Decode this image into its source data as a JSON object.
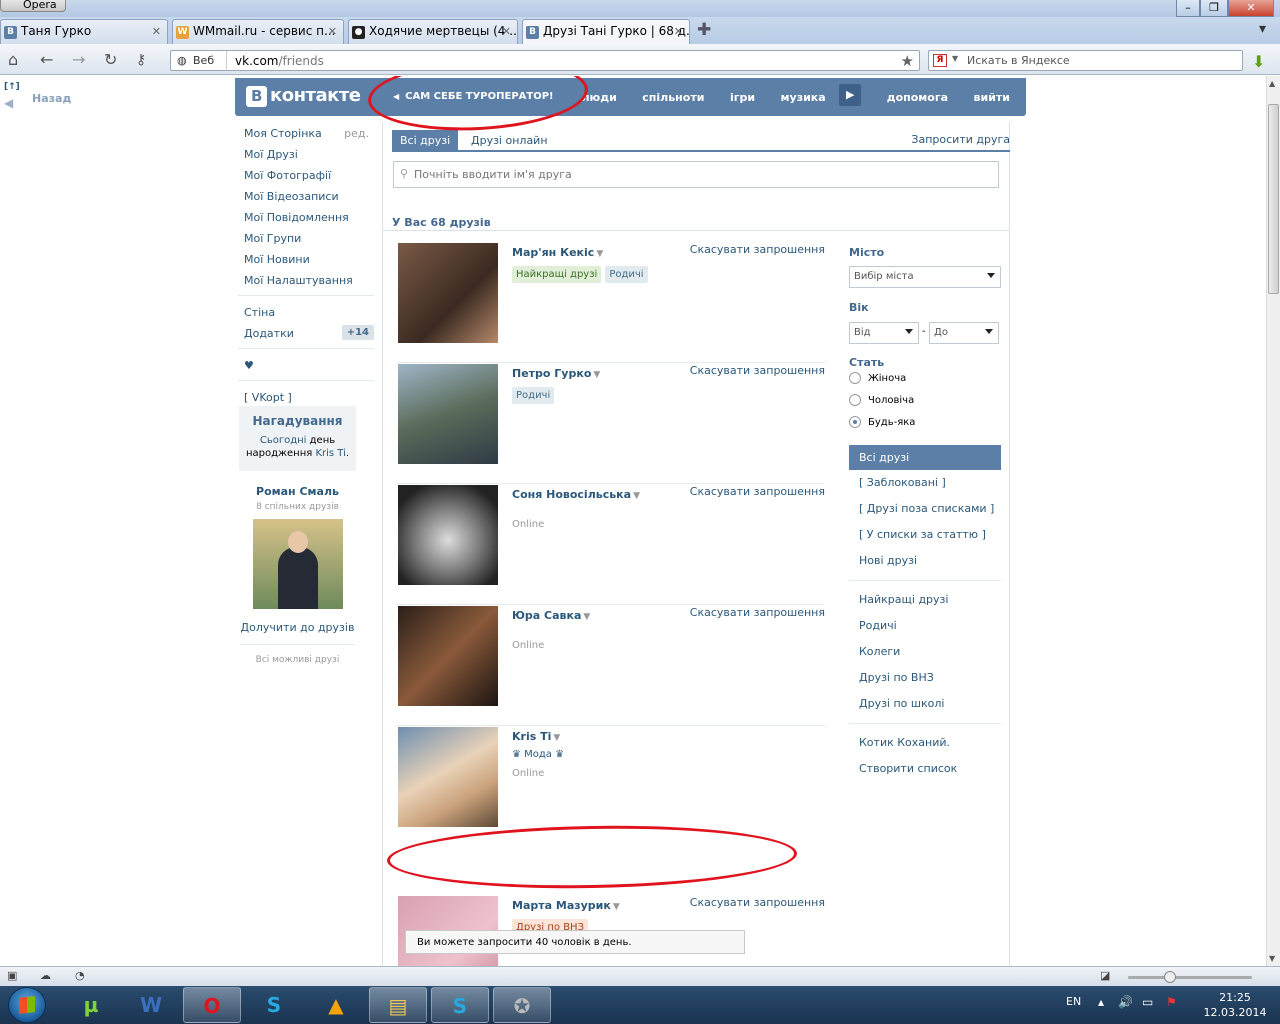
{
  "browser": {
    "app_name": "Opera",
    "tabs": [
      {
        "title": "Таня Гурко",
        "favicon": "В"
      },
      {
        "title": "WMmail.ru - сервис п...",
        "favicon": "W"
      },
      {
        "title": "Ходячие мертвецы (4 ...",
        "favicon": "●"
      },
      {
        "title": "Друзі Тані Гурко | 68 д...",
        "favicon": "В"
      }
    ],
    "url_site": "Веб",
    "url_domain": "vk.com",
    "url_path": "/friends",
    "search_placeholder": "Искать в Яндексе",
    "search_engine": "Я"
  },
  "page": {
    "back_label": "Назад",
    "back_top": "[↑]",
    "logo": "контакте",
    "logo_b": "В",
    "promo": "САМ СЕБЕ ТУРОПЕРАТОР!",
    "top_nav": [
      "люди",
      "спільноти",
      "ігри",
      "музика",
      "допомога",
      "вийти"
    ],
    "left_menu": {
      "edit": "ред.",
      "items": [
        "Моя Сторінка",
        "Мої Друзі",
        "Мої Фотографії",
        "Мої Відеозаписи",
        "Мої Повідомлення",
        "Мої Групи",
        "Мої Новини",
        "Мої Налаштування"
      ],
      "wall": "Стіна",
      "apps": "Додатки",
      "apps_count": "+14",
      "heart": "♥",
      "vkopt": "[ VKopt ]"
    },
    "reminder": {
      "title": "Нагадування",
      "today": "Сьогодні",
      "text_mid": " день народження ",
      "person": "Kris Ti",
      "dot": "."
    },
    "suggestion": {
      "name": "Роман Смаль",
      "mutual": "8 спільних друзів",
      "add": "Долучити до друзів",
      "all": "Всі можливі друзі"
    },
    "friends_tabs": [
      "Всі друзі",
      "Друзі онлайн"
    ],
    "request_friend": "Запросити друга",
    "search_placeholder": "Почніть вводити ім'я друга",
    "count_text": "У Вас 68 друзів",
    "cancel_label": "Скасувати запрошення",
    "online_label": "Online",
    "friends": [
      {
        "name": "Мар'ян Кекіс",
        "tags": [
          {
            "text": "Найкращі друзі",
            "style": "g"
          },
          {
            "text": "Родичі",
            "style": "b"
          }
        ]
      },
      {
        "name": "Петро Гурко",
        "tags": [
          {
            "text": "Родичі",
            "style": "b"
          }
        ]
      },
      {
        "name": "Соня Новосільська",
        "online": true
      },
      {
        "name": "Юра Савка",
        "online": true
      },
      {
        "name": "Kris Ti",
        "status": "♛ Мода ♛",
        "online": true,
        "no_cancel": true
      },
      {
        "name": "Марта Мазурик",
        "tags": [
          {
            "text": "Друзі по ВНЗ",
            "style": "o"
          }
        ]
      }
    ],
    "tooltip": "Ви можете запросити 40 чоловік в день.",
    "filters": {
      "city_label": "Місто",
      "city_value": "Вибір міста",
      "age_label": "Вік",
      "age_from": "Від",
      "age_to": "До",
      "age_dash": "-",
      "sex_label": "Стать",
      "sex_options": [
        "Жіноча",
        "Чоловіча",
        "Будь-яка"
      ],
      "sex_selected": 2,
      "lists_a": [
        "Всі друзі",
        "[ Заблоковані ]",
        "[ Друзі поза списками ]",
        "[ У списки за статтю ]",
        "Нові друзі"
      ],
      "lists_b": [
        "Найкращі друзі",
        "Родичі",
        "Колеги",
        "Друзі по ВНЗ",
        "Друзі по школі"
      ],
      "lists_c": [
        "Котик Коханий.",
        "Створити список"
      ]
    }
  },
  "taskbar": {
    "lang": "EN",
    "time": "21:25",
    "date": "12.03.2014",
    "apps": [
      "utorrent",
      "word",
      "opera",
      "skype",
      "aimp",
      "explorer",
      "skype",
      "game"
    ]
  }
}
